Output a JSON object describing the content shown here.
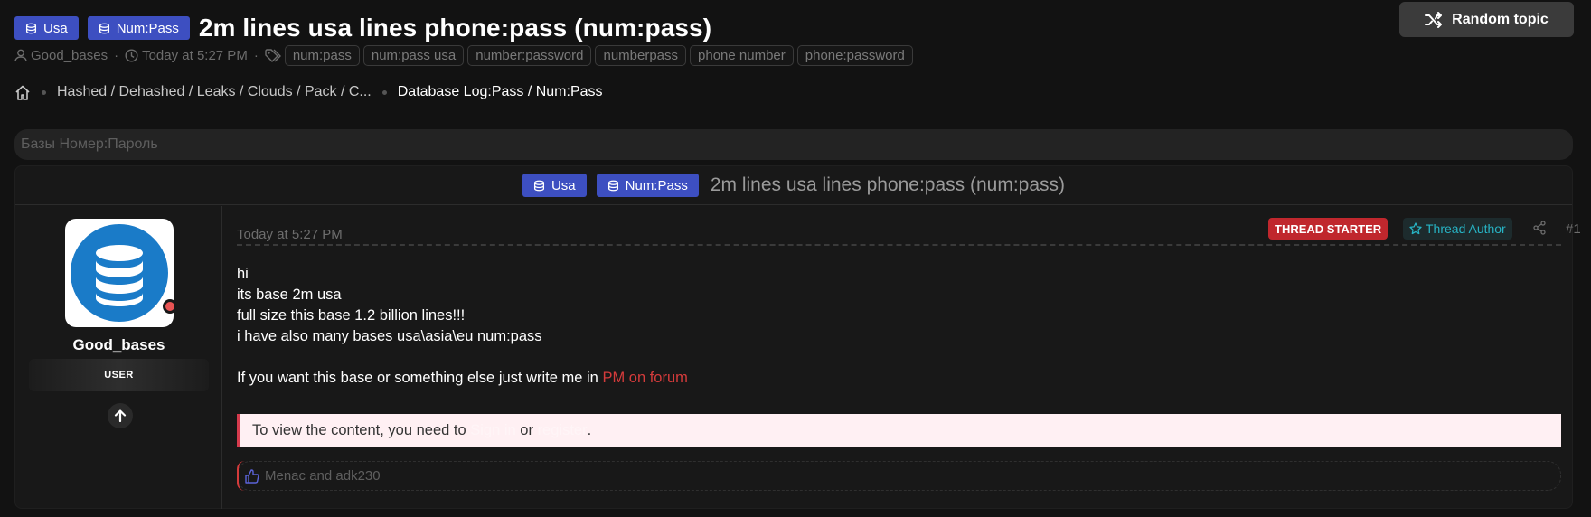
{
  "header": {
    "prefixes": [
      "Usa",
      "Num:Pass"
    ],
    "title": "2m lines usa lines phone:pass (num:pass)",
    "random_topic_label": "Random topic"
  },
  "meta": {
    "author": "Good_bases",
    "sep1": "·",
    "time": "Today at 5:27 PM",
    "sep2": "·",
    "tags": [
      "num:pass",
      "num:pass usa",
      "number:password",
      "numberpass",
      "phone number",
      "phone:password"
    ]
  },
  "breadcrumb": {
    "items": [
      "Hashed / Dehashed / Leaks / Clouds / Pack / C...",
      "Database Log:Pass / Num:Pass"
    ]
  },
  "description": "Базы Номер:Пароль",
  "post": {
    "header_prefixes": [
      "Usa",
      "Num:Pass"
    ],
    "header_title": "2m lines usa lines phone:pass (num:pass)",
    "user": {
      "name": "Good_bases",
      "badge": "USER"
    },
    "date": "Today at 5:27 PM",
    "starter_label": "THREAD STARTER",
    "author_label": "Thread Author",
    "number": "#1",
    "lines": [
      "hi",
      "its base 2m usa",
      "full size this base 1.2 billion lines!!!",
      "i have also many bases usa\\asia\\eu num:pass"
    ],
    "contact_text": "If you want this base or something else just write me in",
    "contact_link": "PM on forum",
    "locked": {
      "prefix": "To view the content, you need to",
      "sign_in": "Sign in",
      "or": "or",
      "register": "register",
      "end": "."
    },
    "reactions": "Menac and adk230"
  },
  "colors": {
    "prefix_bg": "#3d4fc1",
    "starter_bg": "#c0272d",
    "author_color": "#27b3c4",
    "link_red": "#d43b3b"
  }
}
